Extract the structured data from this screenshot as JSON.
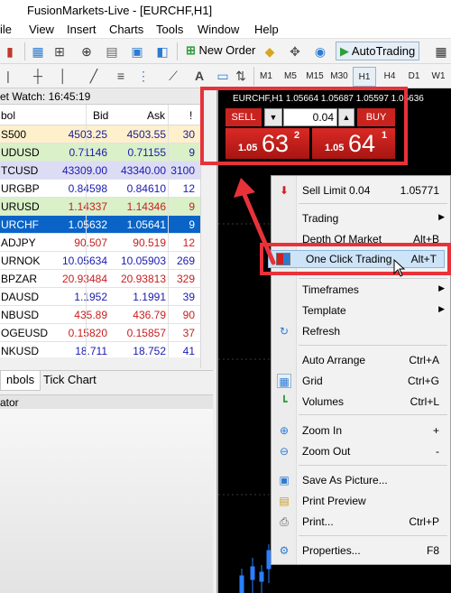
{
  "window": {
    "title": "FusionMarkets-Live - [EURCHF,H1]"
  },
  "menu": [
    "ile",
    "View",
    "Insert",
    "Charts",
    "Tools",
    "Window",
    "Help"
  ],
  "toolbar": {
    "new_order": "New Order",
    "autotrading": "AutoTrading",
    "timeframes": [
      "M1",
      "M5",
      "M15",
      "M30",
      "H1",
      "H4",
      "D1",
      "W1"
    ],
    "active_timeframe": "H1",
    "letter_tool": "A"
  },
  "market_watch": {
    "title": "et Watch: 16:45:19",
    "columns": {
      "symbol": "bol",
      "bid": "Bid",
      "ask": "Ask",
      "spread": "!"
    },
    "rows": [
      {
        "symbol": "S500",
        "bid": "4503.25",
        "ask": "4503.55",
        "spread": "30",
        "bg": "#fff0cc",
        "color": "#1a1a9a"
      },
      {
        "symbol": "UDUSD",
        "bid": "0.71146",
        "ask": "0.71155",
        "spread": "9",
        "bg": "#d9f0c8",
        "color": "#1a1ab0"
      },
      {
        "symbol": "TCUSD",
        "bid": "43309.00",
        "ask": "43340.00",
        "spread": "3100",
        "bg": "#dcdcf4",
        "color": "#1a1ab0"
      },
      {
        "symbol": "URGBP",
        "bid": "0.84598",
        "ask": "0.84610",
        "spread": "12",
        "bg": "#ffffff",
        "color": "#1a1ab0"
      },
      {
        "symbol": "URUSD",
        "bid": "1.14337",
        "ask": "1.14346",
        "spread": "9",
        "bg": "#d9f0c8",
        "color": "#c81e1e"
      },
      {
        "symbol": "URCHF",
        "bid": "1.05632",
        "ask": "1.05641",
        "spread": "9",
        "bg": "#0a64c8",
        "color": "#ffffff"
      },
      {
        "symbol": "ADJPY",
        "bid": "90.507",
        "ask": "90.519",
        "spread": "12",
        "bg": "#ffffff",
        "color": "#c81e1e"
      },
      {
        "symbol": "URNOK",
        "bid": "10.05634",
        "ask": "10.05903",
        "spread": "269",
        "bg": "#ffffff",
        "color": "#1a1ab0"
      },
      {
        "symbol": "BPZAR",
        "bid": "20.93484",
        "ask": "20.93813",
        "spread": "329",
        "bg": "#ffffff",
        "color": "#c81e1e"
      },
      {
        "symbol": "DAUSD",
        "bid": "1.1952",
        "ask": "1.1991",
        "spread": "39",
        "bg": "#ffffff",
        "color": "#1a1ab0"
      },
      {
        "symbol": "NBUSD",
        "bid": "435.89",
        "ask": "436.79",
        "spread": "90",
        "bg": "#ffffff",
        "color": "#c81e1e"
      },
      {
        "symbol": "OGEUSD",
        "bid": "0.15820",
        "ask": "0.15857",
        "spread": "37",
        "bg": "#ffffff",
        "color": "#c81e1e"
      },
      {
        "symbol": "NKUSD",
        "bid": "18.711",
        "ask": "18.752",
        "spread": "41",
        "bg": "#ffffff",
        "color": "#1a1ab0"
      }
    ],
    "tabs": [
      "nbols",
      "Tick Chart"
    ],
    "active_tab": "nbols"
  },
  "navigator": {
    "title": "ator"
  },
  "chart": {
    "title": "EURCHF,H1  1.05664 1.05687 1.05597 1.05636"
  },
  "one_click": {
    "sell_label": "SELL",
    "buy_label": "BUY",
    "lot": "0.04",
    "sell_prefix": "1.05",
    "sell_big": "63",
    "sell_sup": "2",
    "buy_prefix": "1.05",
    "buy_big": "64",
    "buy_sup": "1"
  },
  "context_menu": {
    "sell_limit_label": "Sell Limit 0.04",
    "sell_limit_price": "1.05771",
    "trading": "Trading",
    "depth_of_market": "Depth Of Market",
    "depth_shortcut": "Alt+B",
    "one_click_trading": "One Click Trading",
    "one_click_shortcut": "Alt+T",
    "timeframes": "Timeframes",
    "template": "Template",
    "refresh": "Refresh",
    "auto_arrange": "Auto Arrange",
    "auto_arrange_shortcut": "Ctrl+A",
    "grid": "Grid",
    "grid_shortcut": "Ctrl+G",
    "volumes": "Volumes",
    "volumes_shortcut": "Ctrl+L",
    "zoom_in": "Zoom In",
    "zoom_in_shortcut": "+",
    "zoom_out": "Zoom Out",
    "zoom_out_shortcut": "-",
    "save_as_picture": "Save As Picture...",
    "print_preview": "Print Preview",
    "print": "Print...",
    "print_shortcut": "Ctrl+P",
    "properties": "Properties...",
    "properties_shortcut": "F8"
  },
  "colors": {
    "highlight": "#e8323a",
    "sell_red": "#c9231f",
    "selected_row": "#0a64c8"
  }
}
